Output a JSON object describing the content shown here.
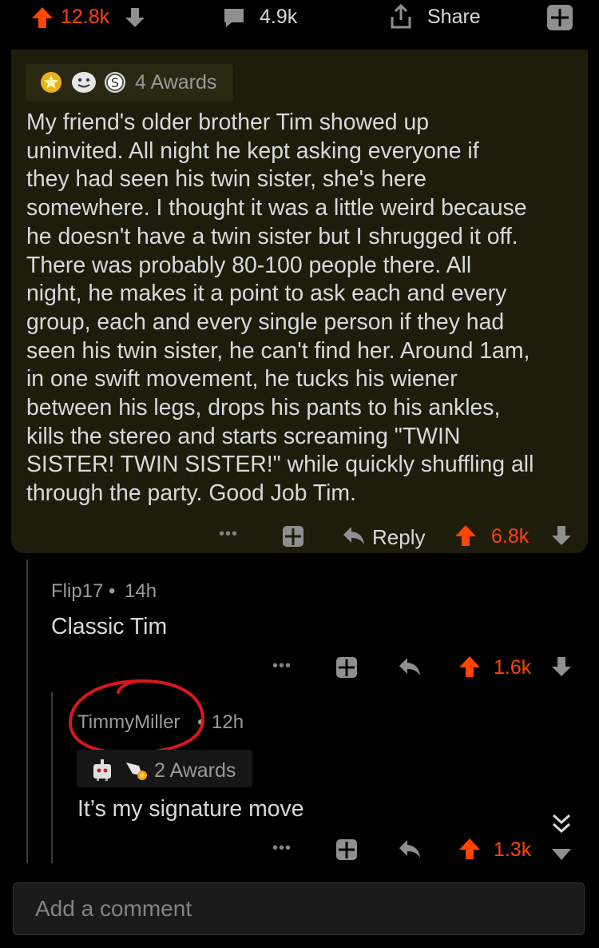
{
  "topbar": {
    "upvotes": "12.8k",
    "comments": "4.9k",
    "share_label": "Share"
  },
  "main_comment": {
    "awards_label": "4 Awards",
    "text": "My friend's older brother Tim showed up\nuninvited. All night he kept asking everyone if\nthey had seen his twin sister, she's here\nsomewhere. I thought it was a little weird because\nhe doesn't have a twin sister but I shrugged it off.\nThere was probably 80-100 people there. All\nnight, he makes it a point to ask each and every\ngroup, each and every single person if they had\nseen his twin sister, he can't find her. Around 1am,\nin one swift movement, he tucks his wiener\nbetween his legs, drops his pants to his ankles,\nkills the stereo and starts screaming \"TWIN\nSISTER! TWIN SISTER!\" while quickly shuffling all\nthrough the party. Good Job Tim.",
    "more": "•••",
    "reply_label": "Reply",
    "score": "6.8k"
  },
  "reply1": {
    "author": "Flip17",
    "time": "14h",
    "text": "Classic Tim",
    "more": "•••",
    "score": "1.6k"
  },
  "reply2": {
    "author": "TimmyMiller",
    "time": "12h",
    "awards_label": "2 Awards",
    "text": "It’s my signature move",
    "more": "•••",
    "score": "1.3k"
  },
  "composer": {
    "placeholder": "Add a comment"
  },
  "colors": {
    "upvote": "#ff4500",
    "annotation_circle": "#d8181d",
    "highlight_bg": "#1e1c0b"
  }
}
